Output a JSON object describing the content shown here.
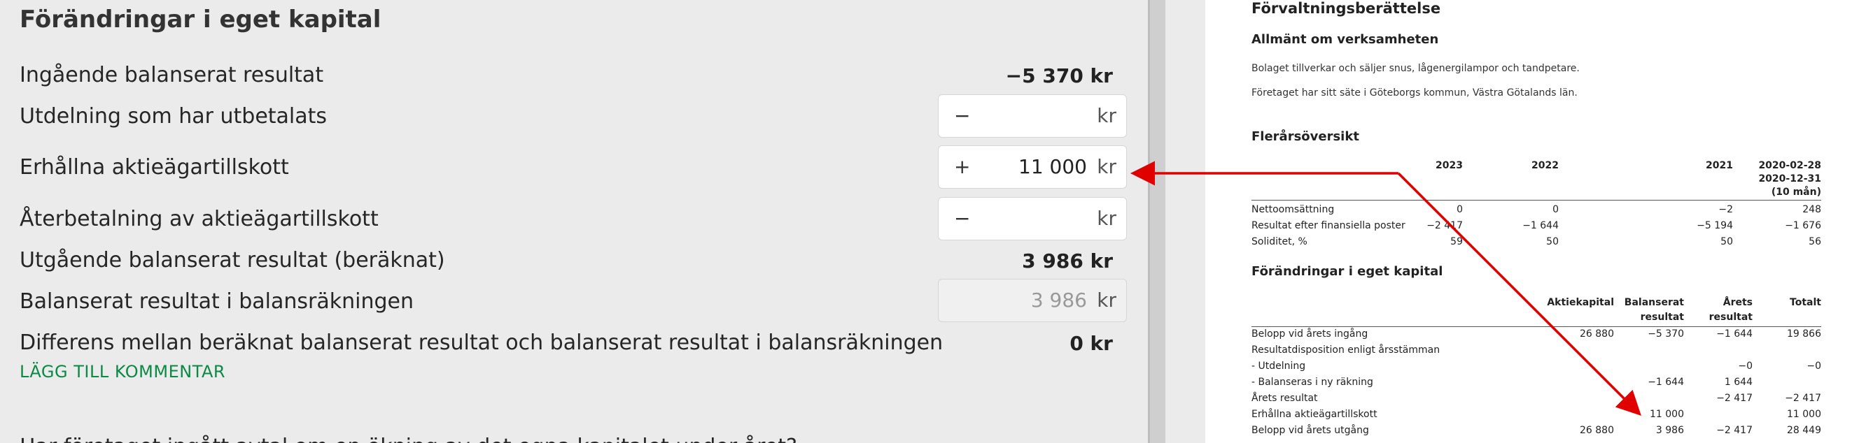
{
  "form": {
    "title": "Förändringar i eget kapital",
    "rows": [
      {
        "label": "Ingående balanserat resultat",
        "value": "−5 370 kr"
      },
      {
        "label": "Utdelning som har utbetalats",
        "sign": "−",
        "amount": "",
        "unit": "kr"
      },
      {
        "label": "Erhållna aktieägartillskott",
        "sign": "+",
        "amount": "11 000",
        "unit": "kr"
      },
      {
        "label": "Återbetalning av aktieägartillskott",
        "sign": "−",
        "amount": "",
        "unit": "kr"
      },
      {
        "label": "Utgående balanserat resultat (beräknat)",
        "value": "3 986 kr"
      },
      {
        "label": "Balanserat resultat i balansräkningen",
        "amount": "3 986",
        "unit": "kr"
      },
      {
        "label": "Differens mellan beräknat balanserat resultat och balanserat resultat i balansräkningen",
        "value": "0 kr"
      }
    ],
    "comment_link": "LÄGG TILL KOMMENTAR",
    "next_question": "Har företaget ingått avtal om en ökning av det egna kapitalet under året?"
  },
  "document": {
    "title": "Förvaltningsberättelse",
    "section1_heading": "Allmänt om verksamheten",
    "section1_p1": "Bolaget tillverkar och säljer snus, lågenergilampor och tandpetare.",
    "section1_p2": "Företaget har sitt säte i Göteborgs kommun, Västra Götalands län.",
    "multi_year": {
      "heading": "Flerårsöversikt",
      "col1": "2023",
      "col2": "2022",
      "col3": "2021",
      "col4_l1": "2020-02-28",
      "col4_l2": "2020-12-31",
      "col4_l3": "(10 mån)",
      "rows": [
        {
          "label": "Nettoomsättning",
          "v": [
            "0",
            "0",
            "−2",
            "248"
          ]
        },
        {
          "label": "Resultat efter finansiella poster",
          "v": [
            "−2 417",
            "−1 644",
            "−5 194",
            "−1 676"
          ]
        },
        {
          "label": "Soliditet, %",
          "v": [
            "59",
            "50",
            "50",
            "56"
          ]
        }
      ]
    },
    "equity": {
      "heading": "Förändringar i eget kapital",
      "h_aktiekapital": "Aktiekapital",
      "h_balanserat_l1": "Balanserat",
      "h_balanserat_l2": "resultat",
      "h_arets_l1": "Årets",
      "h_arets_l2": "resultat",
      "h_totalt": "Totalt",
      "rows": [
        {
          "label": "Belopp vid årets ingång",
          "v": [
            "26 880",
            "−5 370",
            "−1 644",
            "19 866"
          ]
        },
        {
          "label": "Resultatdisposition enligt årsstämman",
          "v": [
            "",
            "",
            "",
            ""
          ]
        },
        {
          "label": "- Utdelning",
          "v": [
            "",
            "",
            "−0",
            "−0"
          ]
        },
        {
          "label": "- Balanseras i ny räkning",
          "v": [
            "",
            "−1 644",
            "1 644",
            ""
          ]
        },
        {
          "label": "Årets resultat",
          "v": [
            "",
            "",
            "−2 417",
            "−2 417"
          ]
        },
        {
          "label": "Erhållna aktieägartillskott",
          "v": [
            "",
            "11 000",
            "",
            "11 000"
          ]
        },
        {
          "label": "Belopp vid årets utgång",
          "v": [
            "26 880",
            "3 986",
            "−2 417",
            "28 449"
          ]
        }
      ]
    }
  },
  "colors": {
    "accent_green": "#0b8a45",
    "arrow_red": "#e00000"
  }
}
